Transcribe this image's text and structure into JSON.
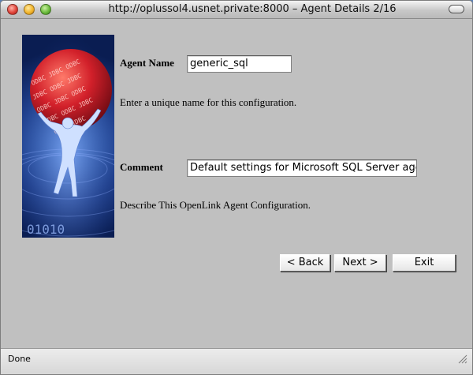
{
  "window": {
    "title": "http://oplussol4.usnet.private:8000 – Agent Details 2/16"
  },
  "form": {
    "agent_name": {
      "label": "Agent Name",
      "value": "generic_sql",
      "description": "Enter a unique name for this configuration."
    },
    "comment": {
      "label": "Comment",
      "value": "Default settings for Microsoft SQL Server ager",
      "description": "Describe This OpenLink Agent Configuration."
    }
  },
  "buttons": {
    "back": "< Back",
    "next": "Next >",
    "exit": "Exit"
  },
  "status": {
    "text": "Done"
  },
  "hero": {
    "sphere_text": "ODBC JDBC ODBC JDBC",
    "binary_text": "01010"
  }
}
